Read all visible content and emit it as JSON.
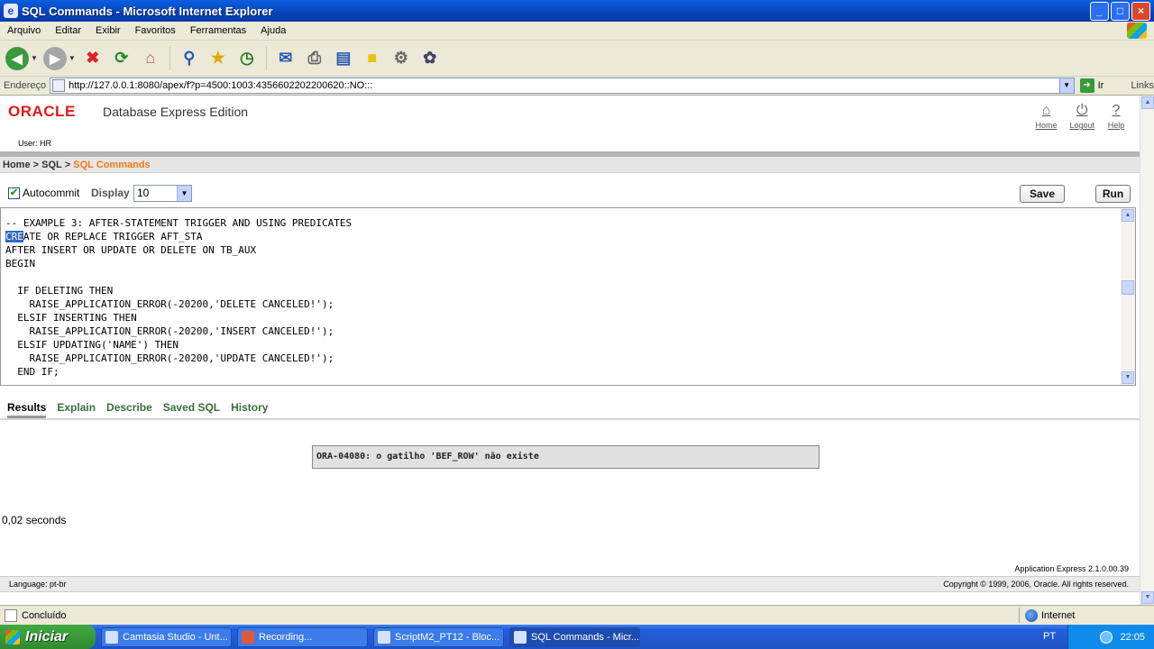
{
  "window": {
    "title": "SQL Commands - Microsoft Internet Explorer",
    "buttons": {
      "minimize": "_",
      "maximize": "□",
      "close": "×"
    }
  },
  "menu": [
    "Arquivo",
    "Editar",
    "Exibir",
    "Favoritos",
    "Ferramentas",
    "Ajuda"
  ],
  "toolbar": {
    "icons": [
      "back-icon",
      "forward-icon",
      "stop-icon",
      "refresh-icon",
      "home-icon",
      "search-icon",
      "favorites-icon",
      "history-icon",
      "mail-icon",
      "print-icon",
      "edit-icon",
      "discuss-icon",
      "research-icon",
      "messenger-icon"
    ]
  },
  "address": {
    "label": "Endereço",
    "url": "http://127.0.0.1:8080/apex/f?p=4500:1003:4356602202200620::NO:::",
    "go_label": "Ir",
    "links_label": "Links"
  },
  "app": {
    "logo": "ORACLE",
    "product": "Database Express Edition",
    "user": "User: HR",
    "links": [
      {
        "label": "Home",
        "icon": "home-icon"
      },
      {
        "label": "Logout",
        "icon": "logout-icon"
      },
      {
        "label": "Help",
        "icon": "help-icon"
      }
    ]
  },
  "breadcrumb": {
    "home": "Home",
    "sep1": " > ",
    "sql": "SQL",
    "sep2": " > ",
    "current": "SQL Commands"
  },
  "controls": {
    "autocommit_label": "Autocommit",
    "autocommit_checked": true,
    "display_label": "Display",
    "display_value": "10",
    "save_label": "Save",
    "run_label": "Run"
  },
  "editor": {
    "lines_before_sel": "",
    "selected": "CRE",
    "code_line0": "-- EXAMPLE 3: AFTER-STATEMENT TRIGGER AND USING PREDICATES",
    "code_line1_rest": "ATE OR REPLACE TRIGGER AFT_STA",
    "code_rest": "AFTER INSERT OR UPDATE OR DELETE ON TB_AUX\nBEGIN\n\n  IF DELETING THEN\n    RAISE_APPLICATION_ERROR(-20200,'DELETE CANCELED!');\n  ELSIF INSERTING THEN\n    RAISE_APPLICATION_ERROR(-20200,'INSERT CANCELED!');\n  ELSIF UPDATING('NAME') THEN\n    RAISE_APPLICATION_ERROR(-20200,'UPDATE CANCELED!');\n  END IF;"
  },
  "tabs": [
    "Results",
    "Explain",
    "Describe",
    "Saved SQL",
    "History"
  ],
  "result": {
    "error": "ORA-04080: o gatilho 'BEF_ROW' não existe",
    "elapsed": "0,02 seconds"
  },
  "footer": {
    "version": "Application Express 2.1.0.00.39",
    "language": "Language: pt-br",
    "copyright": "Copyright © 1999, 2006, Oracle. All rights reserved."
  },
  "status": {
    "text": "Concluído",
    "zone": "Internet"
  },
  "taskbar": {
    "start": "Iniciar",
    "tasks": [
      "Camtasia Studio - Unt...",
      "Recording...",
      "ScriptM2_PT12 - Bloc...",
      "SQL Commands - Micr..."
    ],
    "active_task": 3,
    "lang": "PT",
    "clock": "22:05"
  },
  "colors": {
    "oracle_red": "#e21a1a",
    "breadcrumb_current": "#f07a16",
    "tab_link": "#3b6e3b",
    "xp_titlebar": "#0842b8"
  }
}
